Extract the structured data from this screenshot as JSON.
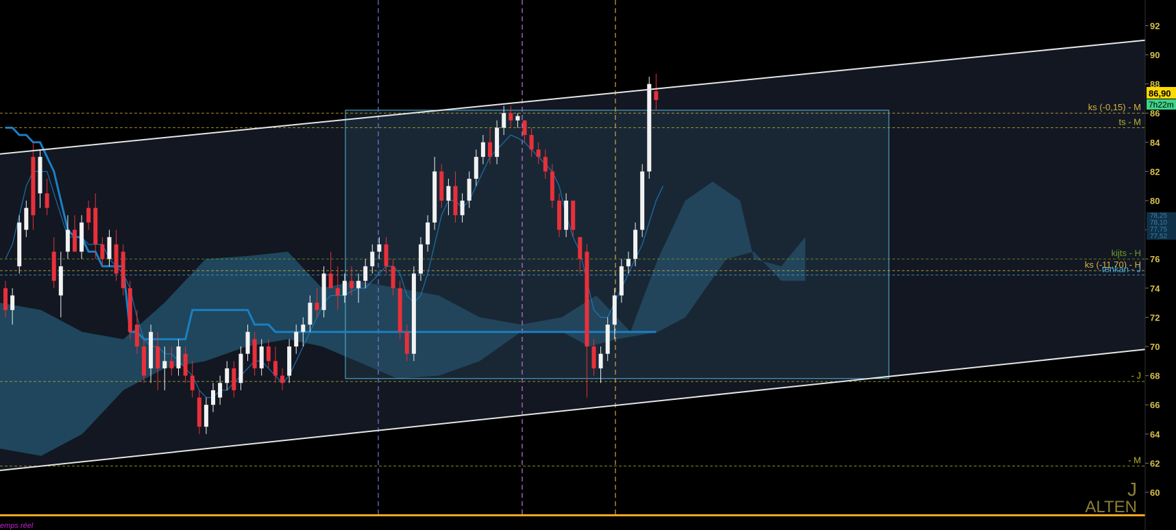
{
  "chart_data": {
    "type": "candlestick",
    "ticker": "ALTEN",
    "timeframe": "J",
    "footer_note": "emps réel",
    "ylim": [
      59,
      93
    ],
    "y_ticks": [
      60,
      62,
      64,
      66,
      68,
      70,
      72,
      74,
      76,
      78,
      80,
      82,
      84,
      86,
      88,
      90,
      92
    ],
    "price_tag": "86,90",
    "time_tag": "7h22m",
    "side_stack": [
      "78,25",
      "78,10",
      "77,75",
      "77,52"
    ],
    "candles": [
      [
        74.0,
        74.5,
        72.0,
        72.5
      ],
      [
        72.5,
        74.0,
        71.5,
        73.5
      ],
      [
        75.5,
        79.0,
        75.0,
        78.5
      ],
      [
        78.0,
        80.0,
        77.5,
        79.5
      ],
      [
        83.0,
        84.0,
        78.0,
        79.0
      ],
      [
        80.5,
        83.5,
        79.5,
        83.0
      ],
      [
        80.5,
        81.5,
        79.0,
        79.5
      ],
      [
        76.5,
        77.5,
        74.0,
        74.5
      ],
      [
        73.5,
        76.5,
        72.0,
        75.5
      ],
      [
        76.5,
        79.0,
        76.0,
        78.0
      ],
      [
        78.0,
        79.0,
        76.5,
        76.5
      ],
      [
        76.5,
        79.0,
        76.0,
        78.5
      ],
      [
        79.5,
        80.0,
        78.0,
        78.5
      ],
      [
        79.5,
        80.5,
        76.0,
        77.0
      ],
      [
        77.0,
        77.5,
        75.5,
        76.0
      ],
      [
        76.0,
        78.0,
        75.5,
        77.5
      ],
      [
        77.0,
        78.0,
        74.5,
        75.0
      ],
      [
        76.5,
        77.0,
        73.5,
        74.0
      ],
      [
        74.0,
        74.5,
        70.5,
        71.0
      ],
      [
        71.5,
        72.5,
        69.5,
        70.0
      ],
      [
        70.0,
        70.5,
        67.5,
        68.0
      ],
      [
        68.5,
        71.5,
        67.5,
        71.0
      ],
      [
        70.0,
        71.0,
        67.0,
        68.5
      ],
      [
        68.5,
        70.0,
        67.0,
        69.0
      ],
      [
        69.0,
        70.0,
        68.0,
        68.5
      ],
      [
        68.5,
        70.5,
        68.0,
        70.0
      ],
      [
        69.5,
        70.0,
        67.5,
        68.0
      ],
      [
        68.0,
        69.0,
        66.5,
        67.0
      ],
      [
        66.5,
        67.0,
        64.0,
        64.5
      ],
      [
        64.5,
        66.5,
        64.0,
        66.0
      ],
      [
        66.0,
        67.5,
        65.5,
        67.0
      ],
      [
        66.5,
        68.0,
        66.0,
        67.5
      ],
      [
        67.5,
        69.0,
        67.0,
        68.5
      ],
      [
        68.5,
        69.0,
        66.5,
        67.0
      ],
      [
        67.5,
        70.0,
        67.0,
        69.5
      ],
      [
        69.5,
        71.5,
        69.0,
        71.0
      ],
      [
        70.5,
        71.0,
        68.0,
        68.5
      ],
      [
        68.5,
        70.5,
        68.0,
        70.0
      ],
      [
        70.0,
        70.5,
        68.5,
        69.0
      ],
      [
        69.0,
        70.0,
        67.5,
        68.0
      ],
      [
        68.0,
        68.5,
        67.0,
        67.5
      ],
      [
        68.0,
        70.5,
        67.5,
        70.0
      ],
      [
        70.0,
        71.5,
        69.5,
        71.0
      ],
      [
        71.0,
        72.0,
        70.0,
        71.5
      ],
      [
        71.5,
        73.5,
        71.0,
        73.0
      ],
      [
        73.0,
        74.0,
        72.0,
        72.5
      ],
      [
        72.5,
        75.5,
        72.0,
        75.0
      ],
      [
        75.0,
        76.5,
        74.0,
        74.0
      ],
      [
        74.0,
        75.5,
        72.5,
        73.5
      ],
      [
        73.5,
        75.0,
        73.0,
        74.5
      ],
      [
        74.5,
        75.5,
        73.5,
        74.0
      ],
      [
        74.0,
        75.0,
        73.0,
        74.5
      ],
      [
        74.5,
        76.0,
        74.0,
        75.5
      ],
      [
        75.5,
        77.0,
        75.0,
        76.5
      ],
      [
        76.5,
        77.5,
        76.0,
        77.0
      ],
      [
        77.0,
        77.5,
        75.0,
        75.5
      ],
      [
        75.5,
        76.0,
        73.5,
        74.0
      ],
      [
        74.0,
        74.5,
        70.5,
        71.0
      ],
      [
        71.0,
        71.5,
        69.0,
        69.5
      ],
      [
        69.5,
        75.5,
        69.0,
        75.0
      ],
      [
        75.0,
        77.5,
        74.5,
        77.0
      ],
      [
        77.0,
        79.0,
        76.5,
        78.5
      ],
      [
        78.5,
        83.0,
        78.0,
        82.0
      ],
      [
        82.0,
        82.5,
        79.5,
        80.0
      ],
      [
        80.0,
        81.5,
        79.0,
        81.0
      ],
      [
        81.0,
        82.0,
        78.5,
        79.0
      ],
      [
        79.0,
        80.5,
        78.5,
        80.0
      ],
      [
        80.0,
        82.0,
        79.5,
        81.5
      ],
      [
        81.5,
        83.5,
        81.0,
        83.0
      ],
      [
        83.0,
        84.5,
        82.5,
        84.0
      ],
      [
        84.0,
        85.0,
        82.5,
        83.0
      ],
      [
        83.0,
        85.5,
        82.5,
        85.0
      ],
      [
        85.0,
        86.5,
        84.5,
        86.0
      ],
      [
        86.0,
        86.5,
        85.0,
        85.5
      ],
      [
        85.5,
        86.0,
        85.0,
        85.8
      ],
      [
        85.5,
        85.5,
        84.0,
        84.5
      ],
      [
        84.5,
        85.0,
        83.0,
        83.5
      ],
      [
        83.5,
        84.0,
        82.5,
        83.0
      ],
      [
        83.0,
        83.5,
        81.5,
        82.0
      ],
      [
        82.0,
        82.5,
        79.5,
        80.0
      ],
      [
        80.0,
        80.5,
        77.5,
        78.0
      ],
      [
        78.0,
        80.5,
        77.5,
        80.0
      ],
      [
        80.0,
        80.0,
        77.5,
        78.0
      ],
      [
        77.5,
        77.5,
        75.0,
        76.0
      ],
      [
        76.5,
        77.0,
        66.5,
        70.0
      ],
      [
        70.0,
        70.5,
        68.0,
        68.5
      ],
      [
        68.5,
        70.0,
        67.5,
        69.5
      ],
      [
        69.5,
        72.0,
        69.0,
        71.5
      ],
      [
        71.5,
        74.0,
        70.5,
        73.5
      ],
      [
        73.5,
        76.0,
        73.0,
        75.5
      ],
      [
        75.5,
        76.5,
        75.0,
        76.0
      ],
      [
        76.0,
        78.5,
        75.5,
        78.0
      ],
      [
        78.0,
        82.5,
        77.5,
        82.0
      ],
      [
        82.0,
        88.5,
        81.5,
        88.0
      ],
      [
        87.5,
        88.7,
        86.2,
        86.9
      ]
    ],
    "kijun": [
      85,
      85,
      84.5,
      84.5,
      84,
      84,
      83,
      82,
      80,
      78,
      77.5,
      77.5,
      76.5,
      76.5,
      75.5,
      75.5,
      75.5,
      75.5,
      71,
      71,
      70.5,
      70.5,
      70.5,
      70.5,
      70.5,
      70.5,
      70.5,
      72.5,
      72.5,
      72.5,
      72.5,
      72.5,
      72.5,
      72.5,
      72.5,
      72.5,
      71.5,
      71.5,
      71.5,
      71,
      71,
      71,
      71,
      71,
      71,
      71,
      71,
      71,
      71,
      71,
      71,
      71,
      71,
      71,
      71,
      71,
      71,
      71,
      71,
      71,
      71,
      71,
      71,
      71,
      71,
      71,
      71,
      71,
      71,
      71,
      71,
      71,
      71,
      71,
      71,
      71,
      71,
      71,
      71,
      71,
      71,
      71,
      71,
      71,
      71,
      71,
      71,
      71,
      71,
      71,
      71,
      71,
      71,
      71,
      71
    ],
    "tenkan": [
      76,
      77,
      79,
      81,
      82,
      82,
      82,
      80.5,
      79,
      77.5,
      77.5,
      77.5,
      77,
      77,
      77,
      76,
      75.5,
      75,
      74,
      72,
      70.5,
      70,
      70,
      69.5,
      69.5,
      69,
      68.5,
      68,
      67,
      66.5,
      66.5,
      67,
      67,
      67.5,
      68,
      68.5,
      69,
      69,
      68.5,
      68,
      67.5,
      68,
      69,
      70,
      71,
      72,
      73,
      73.5,
      73.5,
      73.5,
      73.8,
      74,
      74,
      74.5,
      75,
      75.5,
      75.5,
      75,
      73.5,
      73,
      73.5,
      75,
      77,
      79,
      80,
      80,
      79.5,
      80,
      81,
      82,
      83,
      83.5,
      84,
      84.5,
      84.3,
      84,
      83.5,
      83,
      82.5,
      82,
      81,
      79,
      77.5,
      76.5,
      74.5,
      72.5,
      72,
      72,
      73,
      74,
      75,
      76,
      77,
      78.5,
      80,
      81
    ]
  },
  "levels": [
    {
      "label": "ks (-0,15) - M",
      "value": 86.0,
      "color": "#d9b341"
    },
    {
      "label": "ts - M",
      "value": 85.0,
      "color": "#b7b32c"
    },
    {
      "label": "kijts - H",
      "value": 76.0,
      "color": "#6f9c2a"
    },
    {
      "label": "ks (-11,70) - H",
      "value": 75.2,
      "color": "#d9b341"
    },
    {
      "label": "tenkan - J",
      "value": 74.9,
      "color": "#3ca9d9"
    },
    {
      "label": "- J",
      "value": 67.6,
      "color": "#b7b32c"
    },
    {
      "label": "- M",
      "value": 61.8,
      "color": "#b7b32c"
    }
  ],
  "colors": {
    "bull": "#f2f2f2",
    "bear": "#e8303a",
    "kijun": "#1b7fc2",
    "cloud": "#2a6e8c",
    "channel": "#e6e6e6",
    "axis_text": "#d9c24a",
    "price_tag_bg": "#ffd800",
    "time_tag_bg": "#3fd48a"
  }
}
